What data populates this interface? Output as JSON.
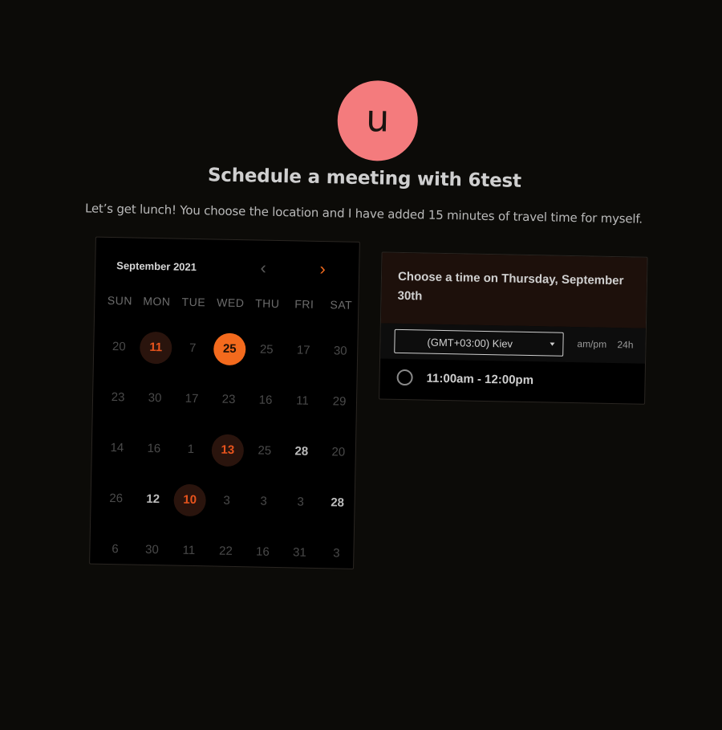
{
  "header": {
    "avatar_letter": "u",
    "title": "Schedule a meeting with 6test",
    "description": "Let’s get lunch! You choose the location and I have added 15 minutes of travel time for myself."
  },
  "calendar": {
    "month_label": "September 2021",
    "prev_icon": "chevron-left-icon",
    "next_icon": "chevron-right-icon",
    "weekdays": [
      "SUN",
      "MON",
      "TUE",
      "WED",
      "THU",
      "FRI",
      "SAT"
    ],
    "weeks": [
      [
        {
          "label": "20",
          "state": "disabled"
        },
        {
          "label": "11",
          "state": "available"
        },
        {
          "label": "7",
          "state": "disabled"
        },
        {
          "label": "25",
          "state": "selected"
        },
        {
          "label": "25",
          "state": "disabled"
        },
        {
          "label": "17",
          "state": "disabled"
        },
        {
          "label": "30",
          "state": "disabled"
        }
      ],
      [
        {
          "label": "23",
          "state": "disabled"
        },
        {
          "label": "30",
          "state": "disabled"
        },
        {
          "label": "17",
          "state": "disabled"
        },
        {
          "label": "23",
          "state": "disabled"
        },
        {
          "label": "16",
          "state": "disabled"
        },
        {
          "label": "11",
          "state": "disabled"
        },
        {
          "label": "29",
          "state": "disabled"
        }
      ],
      [
        {
          "label": "14",
          "state": "disabled"
        },
        {
          "label": "16",
          "state": "disabled"
        },
        {
          "label": "1",
          "state": "disabled"
        },
        {
          "label": "13",
          "state": "available"
        },
        {
          "label": "25",
          "state": "disabled"
        },
        {
          "label": "28",
          "state": "bold"
        },
        {
          "label": "20",
          "state": "disabled"
        }
      ],
      [
        {
          "label": "26",
          "state": "disabled"
        },
        {
          "label": "12",
          "state": "bold"
        },
        {
          "label": "10",
          "state": "available"
        },
        {
          "label": "3",
          "state": "disabled"
        },
        {
          "label": "3",
          "state": "disabled"
        },
        {
          "label": "3",
          "state": "disabled"
        },
        {
          "label": "28",
          "state": "bold"
        }
      ],
      [
        {
          "label": "6",
          "state": "disabled"
        },
        {
          "label": "30",
          "state": "disabled"
        },
        {
          "label": "11",
          "state": "disabled"
        },
        {
          "label": "22",
          "state": "disabled"
        },
        {
          "label": "16",
          "state": "disabled"
        },
        {
          "label": "31",
          "state": "disabled"
        },
        {
          "label": "3",
          "state": "disabled"
        }
      ]
    ]
  },
  "time_panel": {
    "heading": "Choose a time on Thursday, September 30th",
    "timezone_value": "(GMT+03:00) Kiev",
    "format_ampm": "am/pm",
    "format_24h": "24h",
    "slots": [
      "11:00am - 12:00pm"
    ]
  },
  "colors": {
    "background": "#0c0b08",
    "accent": "#f36a1d",
    "avatar": "#f47b7d",
    "panel_header": "#1d100b"
  }
}
